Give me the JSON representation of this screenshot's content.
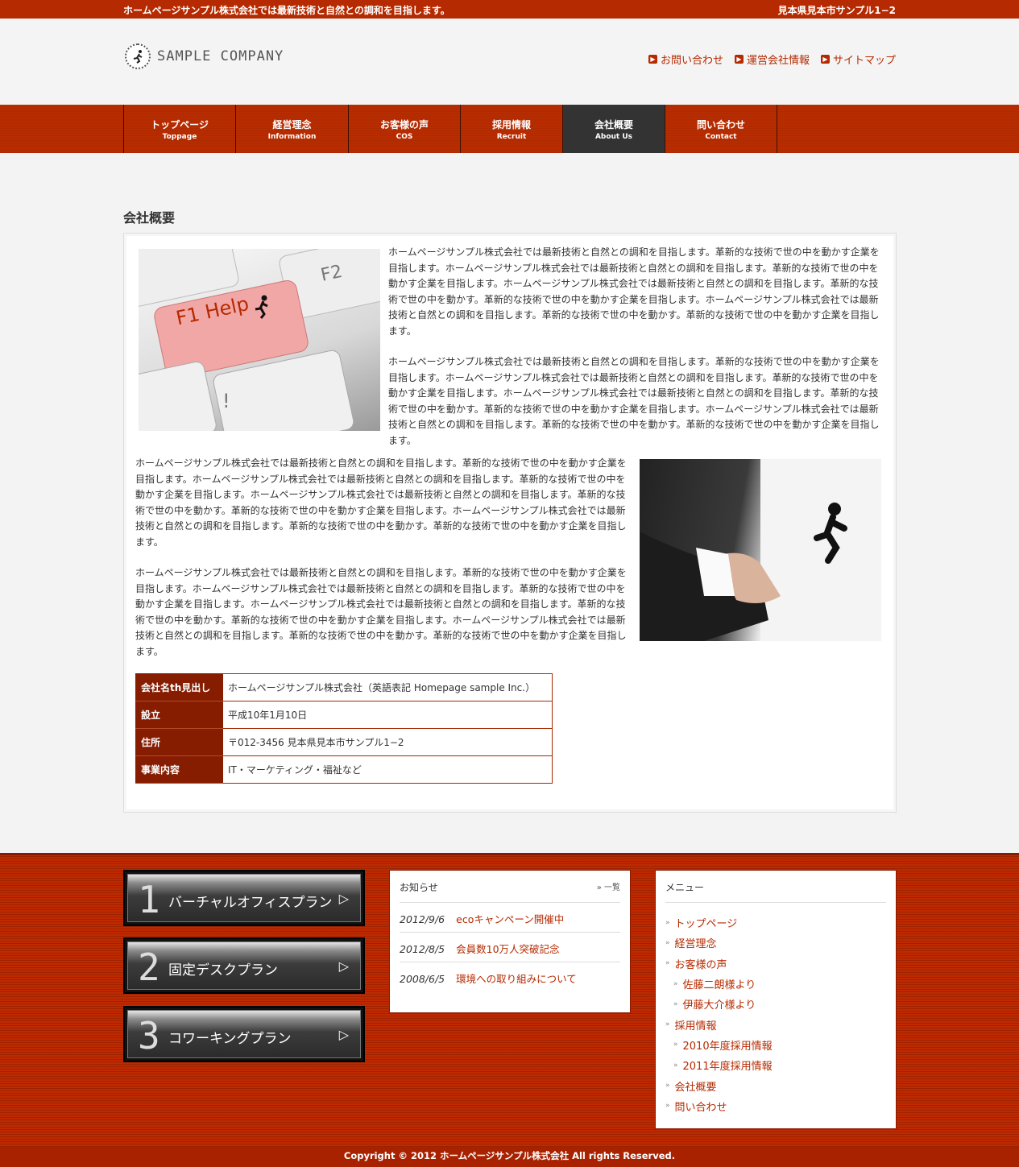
{
  "topbar": {
    "tagline": "ホームページサンプル株式会社では最新技術と自然との調和を目指します。",
    "address": "見本県見本市サンプル1−2"
  },
  "header": {
    "logo_text": "SAMPLE COMPANY",
    "links": [
      {
        "label": "お問い合わせ"
      },
      {
        "label": "運営会社情報"
      },
      {
        "label": "サイトマップ"
      }
    ]
  },
  "nav": {
    "items": [
      {
        "ja": "トップページ",
        "en": "Toppage"
      },
      {
        "ja": "経営理念",
        "en": "Information"
      },
      {
        "ja": "お客様の声",
        "en": "COS"
      },
      {
        "ja": "採用情報",
        "en": "Recruit"
      },
      {
        "ja": "会社概要",
        "en": "About Us"
      },
      {
        "ja": "問い合わせ",
        "en": "Contact"
      }
    ],
    "active_index": 4
  },
  "main": {
    "title": "会社概要",
    "paragraph": "ホームページサンプル株式会社では最新技術と自然との調和を目指します。革新的な技術で世の中を動かす企業を目指します。ホームページサンプル株式会社では最新技術と自然との調和を目指します。革新的な技術で世の中を動かす企業を目指します。ホームページサンプル株式会社では最新技術と自然との調和を目指します。革新的な技術で世の中を動かす。革新的な技術で世の中を動かす企業を目指します。ホームページサンプル株式会社では最新技術と自然との調和を目指します。革新的な技術で世の中を動かす。革新的な技術で世の中を動かす企業を目指します。",
    "image1_text": "F1 Help",
    "image1_key2": "F2",
    "table": [
      {
        "th": "会社名th見出し",
        "td": "ホームページサンプル株式会社（英語表記 Homepage sample Inc.）"
      },
      {
        "th": "設立",
        "td": "平成10年1月10日"
      },
      {
        "th": "住所",
        "td": "〒012-3456 見本県見本市サンプル1−2"
      },
      {
        "th": "事業内容",
        "td": "IT・マーケティング・福祉など"
      }
    ]
  },
  "plans": [
    {
      "num": "1",
      "label": "バーチャルオフィスプラン"
    },
    {
      "num": "2",
      "label": "固定デスクプラン"
    },
    {
      "num": "3",
      "label": "コワーキングプラン"
    }
  ],
  "news": {
    "heading": "お知らせ",
    "more": "一覧",
    "items": [
      {
        "date": "2012/9/6",
        "title": "ecoキャンペーン開催中"
      },
      {
        "date": "2012/8/5",
        "title": "会員数10万人突破記念"
      },
      {
        "date": "2008/6/5",
        "title": "環境への取り組みについて"
      }
    ]
  },
  "menu": {
    "heading": "メニュー",
    "items": [
      {
        "label": "トップページ",
        "sub": false
      },
      {
        "label": "経営理念",
        "sub": false
      },
      {
        "label": "お客様の声",
        "sub": false
      },
      {
        "label": "佐藤二朗様より",
        "sub": true
      },
      {
        "label": "伊藤大介様より",
        "sub": true
      },
      {
        "label": "採用情報",
        "sub": false
      },
      {
        "label": "2010年度採用情報",
        "sub": true
      },
      {
        "label": "2011年度採用情報",
        "sub": true
      },
      {
        "label": "会社概要",
        "sub": false
      },
      {
        "label": "問い合わせ",
        "sub": false
      }
    ]
  },
  "footer": {
    "copyright": "Copyright © 2012 ホームページサンプル株式会社 All rights Reserved."
  },
  "colors": {
    "brand": "#b52a00",
    "dark": "#861c00",
    "nav_active": "#333333"
  }
}
